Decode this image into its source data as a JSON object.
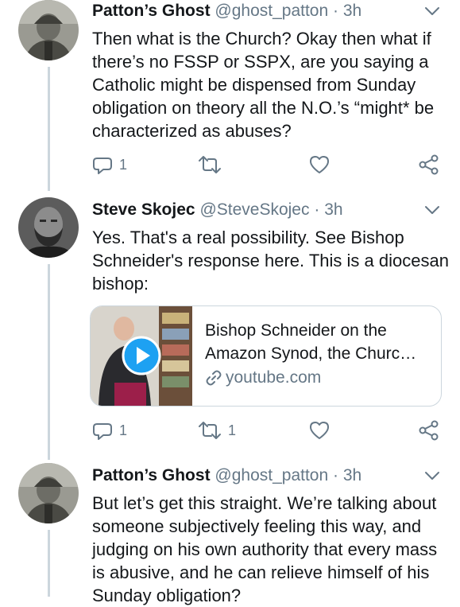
{
  "tweets": [
    {
      "name": "Patton’s Ghost",
      "handle": "@ghost_patton",
      "dot": "·",
      "time": "3h",
      "text": "Then what is the Church? Okay then what if there’s no FSSP or SSPX, are you saying a Catholic might be dispensed from Sunday obligation on theory all the N.O.’s “might* be characterized as abuses?",
      "reply_count": "1",
      "retweet_count": "",
      "like_count": ""
    },
    {
      "name": "Steve Skojec",
      "handle": "@SteveSkojec",
      "dot": "·",
      "time": "3h",
      "text": "Yes. That's a real possibility. See Bishop Schneider's response here. This is a diocesan bishop:",
      "card": {
        "title": "Bishop Schneider on the Amazon Synod, the Churc…",
        "domain": "youtube.com"
      },
      "reply_count": "1",
      "retweet_count": "1",
      "like_count": ""
    },
    {
      "name": "Patton’s Ghost",
      "handle": "@ghost_patton",
      "dot": "·",
      "time": "3h",
      "text": "But let’s get this straight. We’re talking about someone subjectively feeling this way, and judging on his own authority that every mass is abusive, and he can relieve himself of his Sunday obligation?"
    }
  ],
  "icons": {
    "reply": "reply-icon",
    "retweet": "retweet-icon",
    "like": "heart-icon",
    "share": "share-icon",
    "more": "chevron-down-icon",
    "play": "play-icon",
    "link": "link-icon"
  },
  "colors": {
    "text": "#14171a",
    "secondary": "#657786",
    "divider": "#ccd6dd",
    "accent": "#1da1f2"
  }
}
